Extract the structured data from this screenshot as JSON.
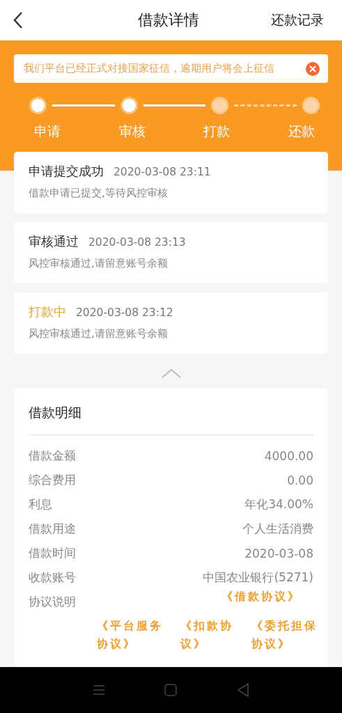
{
  "header": {
    "title": "借款详情",
    "action": "还款记录"
  },
  "notice": {
    "text": "我们平台已经正式对接国家征信，逾期用户将会上征信"
  },
  "steps": [
    {
      "label": "申请",
      "done": true
    },
    {
      "label": "审核",
      "done": true
    },
    {
      "label": "打款",
      "done": false
    },
    {
      "label": "还款",
      "done": false
    }
  ],
  "timeline": [
    {
      "title": "申请提交成功",
      "time": "2020-03-08 23:11",
      "desc": "借款申请已提交,等待风控审核",
      "current": false
    },
    {
      "title": "审核通过",
      "time": "2020-03-08 23:13",
      "desc": "风控审核通过,请留意账号余额",
      "current": false
    },
    {
      "title": "打款中",
      "time": "2020-03-08 23:12",
      "desc": "风控审核通过,请留意账号余额",
      "current": true
    }
  ],
  "details": {
    "title": "借款明细",
    "rows": [
      {
        "label": "借款金额",
        "value": "4000.00"
      },
      {
        "label": "综合费用",
        "value": "0.00"
      },
      {
        "label": "利息",
        "value": "年化34.00%"
      },
      {
        "label": "借款用途",
        "value": "个人生活消费"
      },
      {
        "label": "借款时间",
        "value": "2020-03-08"
      },
      {
        "label": "收款账号",
        "value": "中国农业银行(5271)"
      }
    ],
    "agreement_label": "协议说明",
    "agreements": [
      "《借款协议》",
      "《平台服务协议》",
      "《扣款协议》",
      "《委托担保协议》"
    ]
  }
}
